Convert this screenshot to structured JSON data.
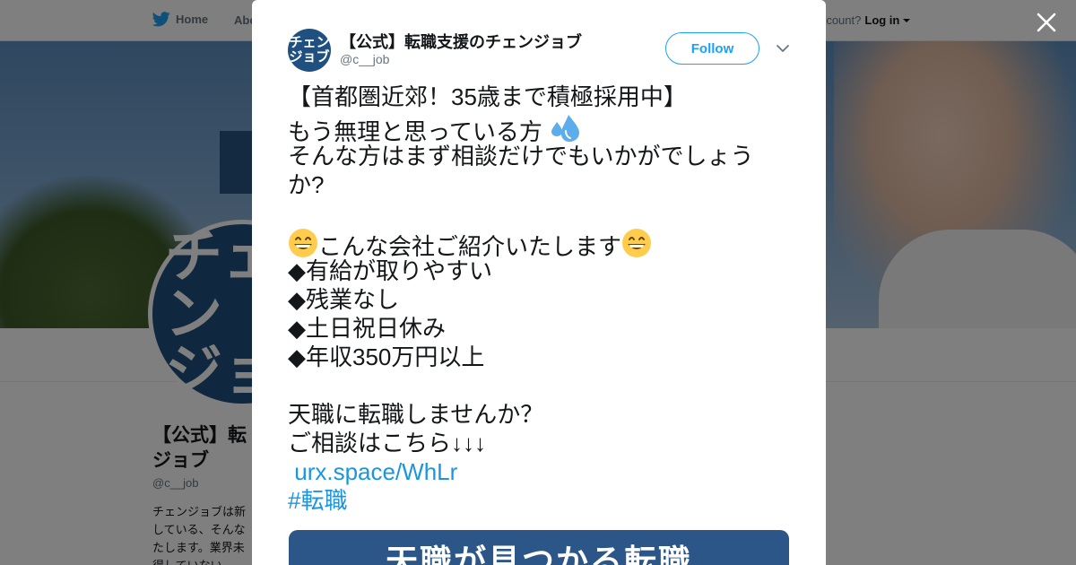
{
  "background": {
    "nav": {
      "home_label": "Home",
      "about_label": "Abo",
      "account_prompt": "ccount?",
      "login_label": "Log in"
    },
    "profile": {
      "avatar_lines": [
        "チェン",
        "ジョ"
      ],
      "name": "【公式】転\nジョブ",
      "handle": "@c__job",
      "bio": "チェンジョブは新\nしている、そんな\nたします。業界未\n得していない。"
    }
  },
  "modal": {
    "author": {
      "avatar_lines": [
        "チェン",
        "ジョブ"
      ],
      "display_name": "【公式】転職支援のチェンジョブ",
      "handle": "@c__job"
    },
    "follow_label": "Follow",
    "tweet": {
      "line1": "【首都圏近郊！35歳まで積極採用中】",
      "line2": "もう無理と思っている方",
      "line3": "そんな方はまず相談だけでもいかがでしょうか?",
      "line4": "こんな会社ご紹介いたします",
      "bullet1": "◆有給が取りやすい",
      "bullet2": "◆残業なし",
      "bullet3": "◆土日祝日休み",
      "bullet4": "◆年収350万円以上",
      "line5": "天職に転職しませんか？",
      "line6": "ご相談はこちら↓↓↓",
      "link": "urx.space/WhLr",
      "hashtag": "#転職"
    },
    "card_title": "天職が見つかる転職"
  },
  "icons": [
    "twitter-bird-icon",
    "caret-down-icon",
    "close-icon",
    "sweat-droplets-emoji",
    "grinning-face-emoji",
    "chevron-down-icon"
  ],
  "colors": {
    "twitter_blue": "#1da1f2",
    "link_blue": "#1b95e0",
    "brand_navy": "#20507f",
    "card_navy": "#2b5687"
  }
}
